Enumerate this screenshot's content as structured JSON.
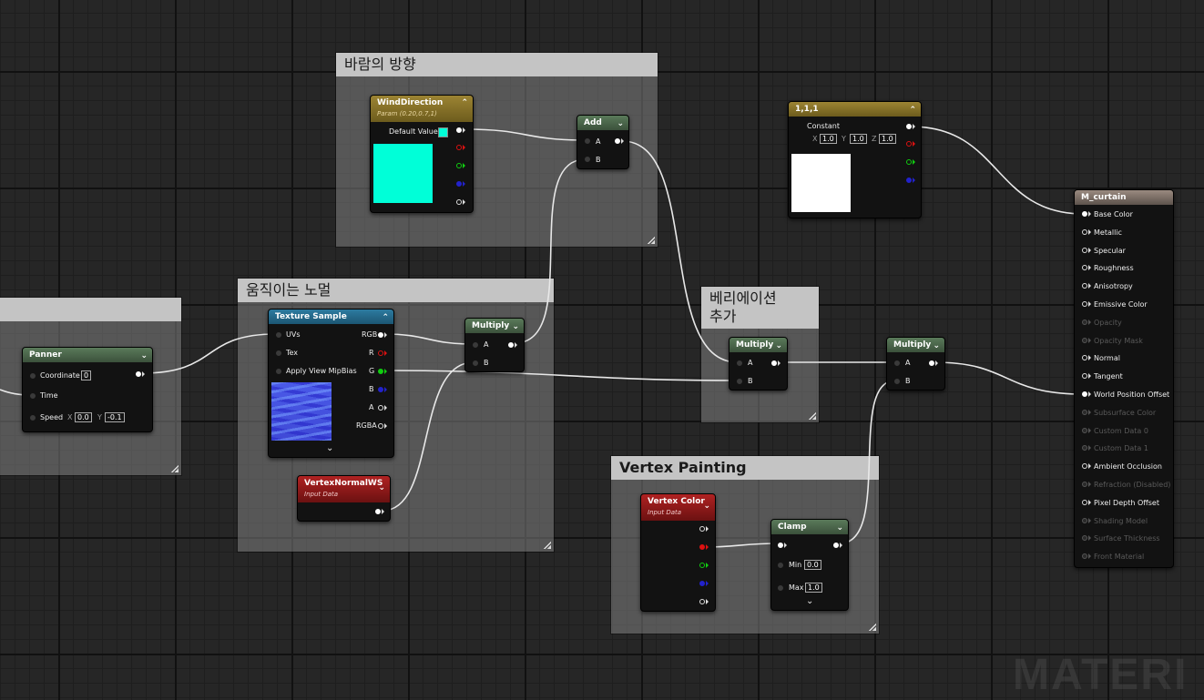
{
  "comments": {
    "wind_direction": "바람의 방향",
    "moving_normal": "움직이는 노멀",
    "add_variation": "베리에이션\n추가",
    "vertex_painting": "Vertex Painting"
  },
  "nodes": {
    "wind_direction": {
      "title": "WindDirection",
      "subtitle": "Param (0.20,0.7,1)",
      "default_label": "Default Value",
      "preview_color": "#00ffd8"
    },
    "add": {
      "title": "Add",
      "in_a": "A",
      "in_b": "B"
    },
    "constant": {
      "title": "1,1,1",
      "label": "Constant",
      "x_label": "X",
      "x_value": "1.0",
      "y_label": "Y",
      "y_value": "1.0",
      "z_label": "Z",
      "z_value": "1.0"
    },
    "panner": {
      "title": "Panner",
      "coordinate_label": "Coordinate",
      "coordinate_value": "0",
      "time_label": "Time",
      "speed_label": "Speed",
      "speed_x_label": "X",
      "speed_x": "0.0",
      "speed_y_label": "Y",
      "speed_y": "-0.1"
    },
    "texture_sample": {
      "title": "Texture Sample",
      "uvs": "UVs",
      "tex": "Tex",
      "mip": "Apply View MipBias",
      "rgb": "RGB",
      "r": "R",
      "g": "G",
      "b": "B",
      "a": "A",
      "rgba": "RGBA"
    },
    "multiply_1": {
      "title": "Multiply",
      "in_a": "A",
      "in_b": "B"
    },
    "multiply_2": {
      "title": "Multiply",
      "in_a": "A",
      "in_b": "B"
    },
    "multiply_3": {
      "title": "Multiply",
      "in_a": "A",
      "in_b": "B"
    },
    "vertex_normal": {
      "title": "VertexNormalWS",
      "subtitle": "Input Data"
    },
    "vertex_color": {
      "title": "Vertex Color",
      "subtitle": "Input Data"
    },
    "clamp": {
      "title": "Clamp",
      "min_label": "Min",
      "min_value": "0.0",
      "max_label": "Max",
      "max_value": "1.0"
    },
    "result": {
      "title": "M_curtain",
      "pins": [
        {
          "label": "Base Color",
          "active": true,
          "connected": true
        },
        {
          "label": "Metallic",
          "active": true,
          "connected": false
        },
        {
          "label": "Specular",
          "active": true,
          "connected": false
        },
        {
          "label": "Roughness",
          "active": true,
          "connected": false
        },
        {
          "label": "Anisotropy",
          "active": true,
          "connected": false
        },
        {
          "label": "Emissive Color",
          "active": true,
          "connected": false
        },
        {
          "label": "Opacity",
          "active": false,
          "connected": false
        },
        {
          "label": "Opacity Mask",
          "active": false,
          "connected": false
        },
        {
          "label": "Normal",
          "active": true,
          "connected": false
        },
        {
          "label": "Tangent",
          "active": true,
          "connected": false
        },
        {
          "label": "World Position Offset",
          "active": true,
          "connected": true
        },
        {
          "label": "Subsurface Color",
          "active": false,
          "connected": false
        },
        {
          "label": "Custom Data 0",
          "active": false,
          "connected": false
        },
        {
          "label": "Custom Data 1",
          "active": false,
          "connected": false
        },
        {
          "label": "Ambient Occlusion",
          "active": true,
          "connected": false
        },
        {
          "label": "Refraction (Disabled)",
          "active": false,
          "connected": false
        },
        {
          "label": "Pixel Depth Offset",
          "active": true,
          "connected": false
        },
        {
          "label": "Shading Model",
          "active": false,
          "connected": false
        },
        {
          "label": "Surface Thickness",
          "active": false,
          "connected": false
        },
        {
          "label": "Front Material",
          "active": false,
          "connected": false
        }
      ]
    }
  },
  "colors": {
    "wire": "#e8e8e8",
    "pin_red": "#d11",
    "pin_green": "#1c1",
    "pin_blue": "#22c"
  },
  "watermark": "MATERI"
}
